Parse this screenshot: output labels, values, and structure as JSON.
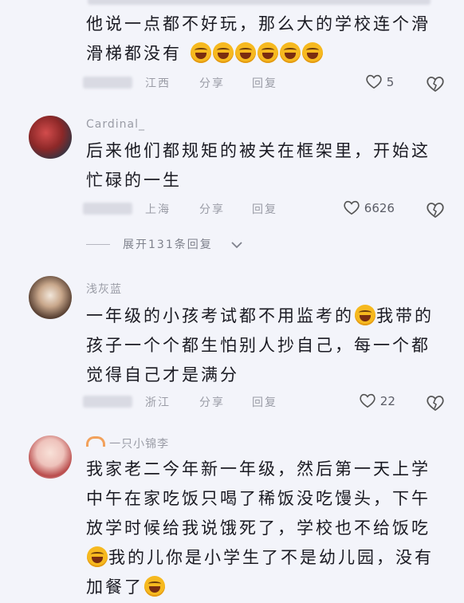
{
  "comments": [
    {
      "name": "",
      "lines": [
        "他说一点都不好玩，那么大的学校连个滑",
        "滑梯都没有"
      ],
      "emoji_count": 6,
      "location": "江西",
      "share": "分享",
      "reply": "回复",
      "likes": "5"
    },
    {
      "name": "Cardinal_",
      "lines": [
        "后来他们都规矩的被关在框架里，开始这",
        "忙碌的一生"
      ],
      "location": "上海",
      "share": "分享",
      "reply": "回复",
      "likes": "6626"
    },
    {
      "name": "浅灰蓝",
      "lines": [
        "一年级的小孩考试都不用监考的",
        "我带的",
        "孩子一个个都生怕别人抄自己，每一个都",
        "觉得自己才是满分"
      ],
      "location": "浙江",
      "share": "分享",
      "reply": "回复",
      "likes": "22"
    },
    {
      "name": "一只小锦李",
      "lines": [
        "我家老二今年新一年级，然后第一天上学",
        "中午在家吃饭只喝了稀饭没吃馒头，下午",
        "放学时候给我说饿死了，学校也不给饭吃",
        "我的儿你是小学生了不是幼儿园，没有",
        "加餐了"
      ]
    }
  ],
  "expand_replies": "展开131条回复",
  "colors": {
    "background": "#f3f4fa",
    "meta": "#9a9ca6",
    "text": "#1a1a22"
  },
  "icons": [
    "heart-icon",
    "dislike-heart-icon",
    "chevron-down-icon",
    "emoji-laugh-icon",
    "emoji-cry-laugh-icon"
  ]
}
